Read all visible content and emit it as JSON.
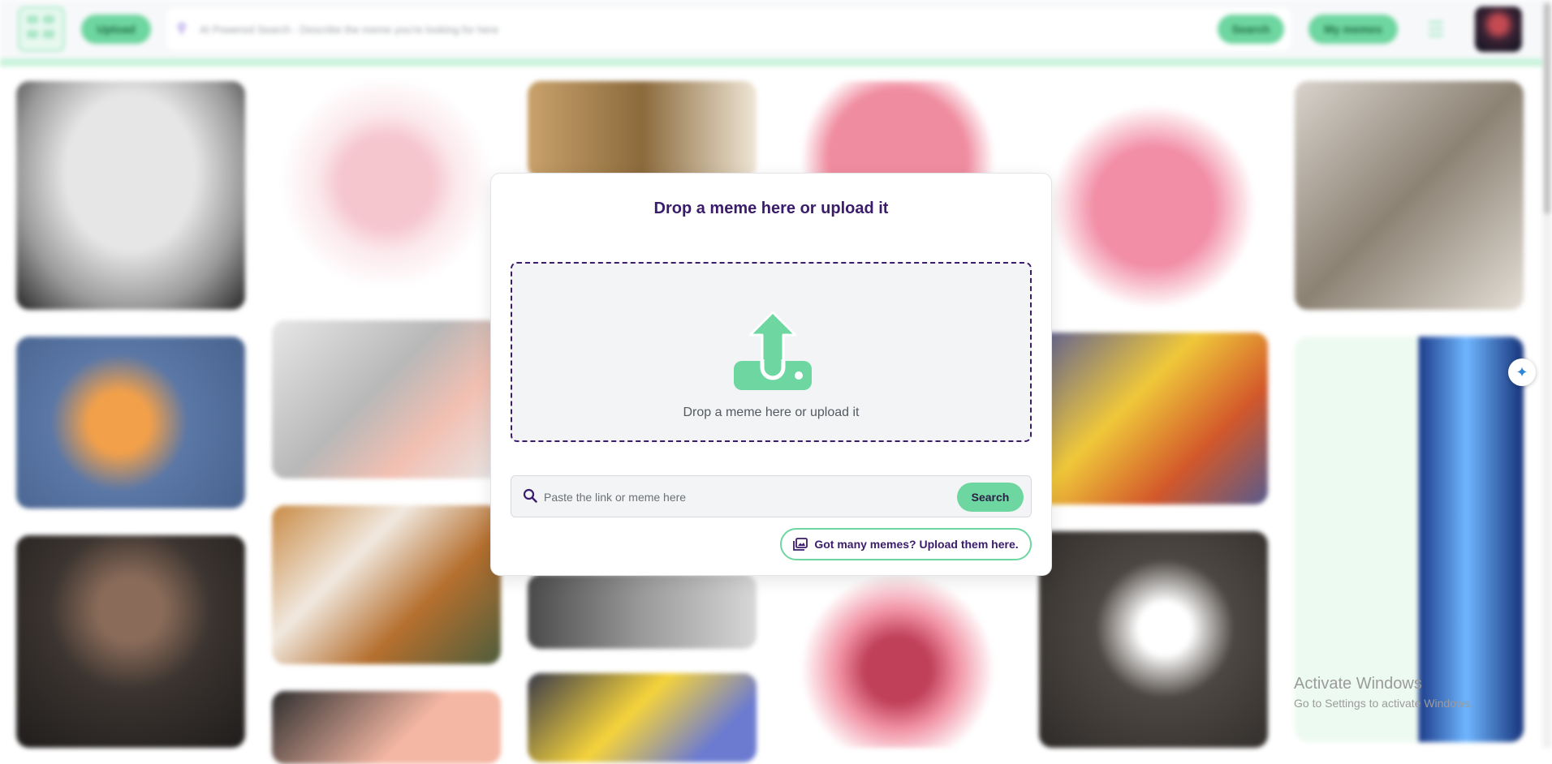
{
  "header": {
    "upload_label": "Upload",
    "search_placeholder": "AI Powered Search - Describe the meme you're looking for here",
    "search_label": "Search",
    "my_memes_label": "My memes"
  },
  "modal": {
    "title": "Drop a meme here or upload it",
    "dropzone_text": "Drop a meme here or upload it",
    "link_placeholder": "Paste the link or meme here",
    "search_label": "Search",
    "bulk_upload_label": "Got many memes? Upload them here."
  },
  "watermark": {
    "line1": "Activate Windows",
    "line2": "Go to Settings to activate Windows."
  },
  "colors": {
    "accent_green": "#6ed6a0",
    "brand_purple": "#3b1c6b",
    "dropzone_bg": "#f3f4f6"
  },
  "icons": {
    "upload": "upload-arrow-icon",
    "search": "search-icon",
    "images": "images-icon",
    "float": "water-drop-sparkle-icon"
  }
}
